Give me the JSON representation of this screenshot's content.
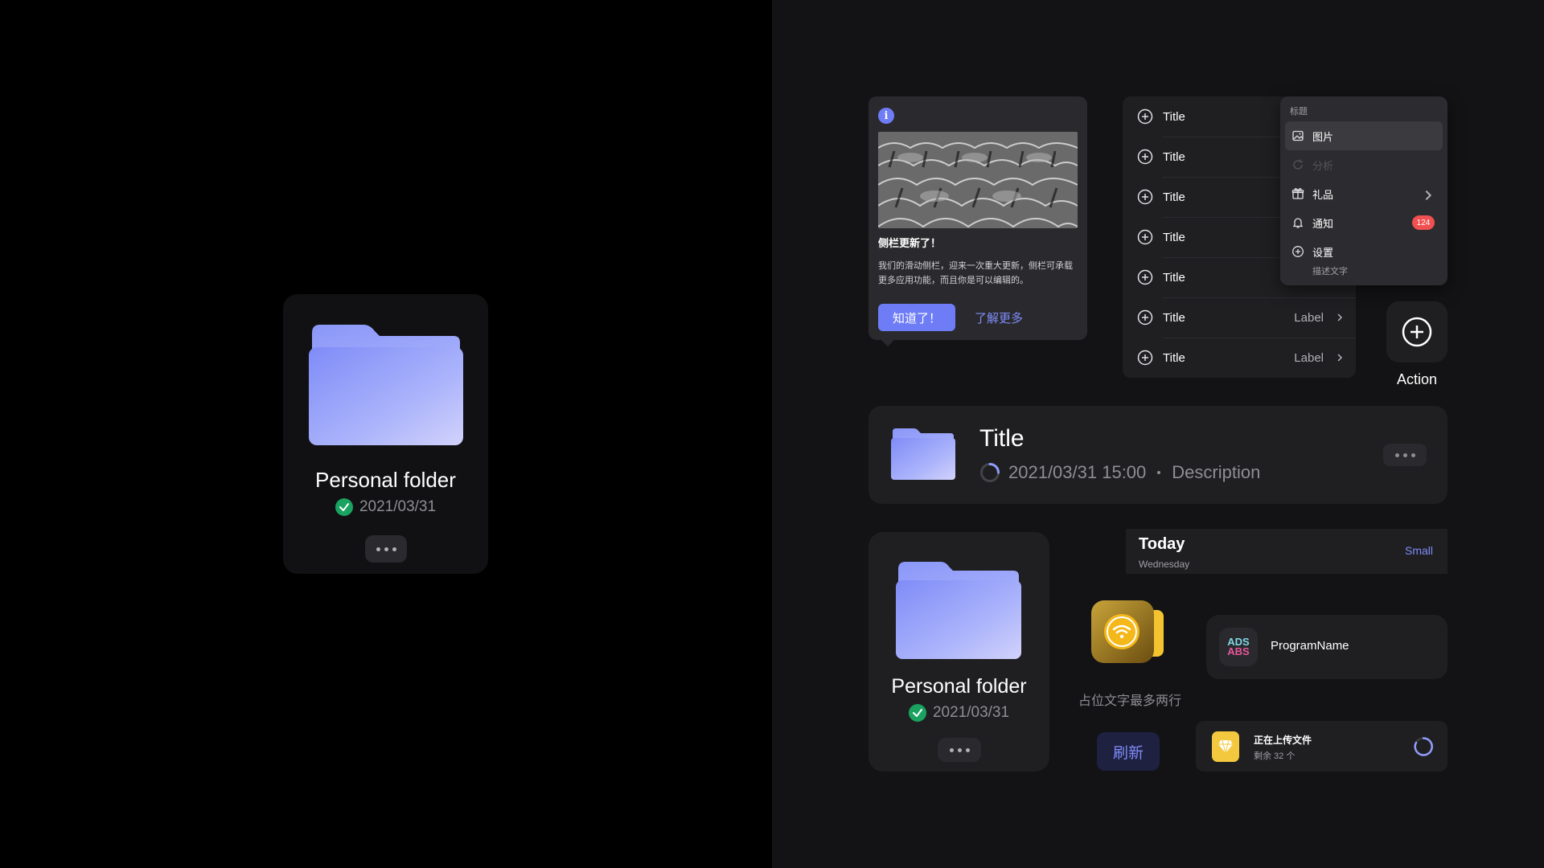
{
  "big_folder": {
    "name": "Personal folder",
    "date": "2021/03/31"
  },
  "popover": {
    "title": "侧栏更新了！",
    "body": "我们的滑动侧栏，迎来一次重大更新，侧栏可承载更多应用功能，而且你是可以编辑的。",
    "primary_button": "知道了！",
    "link_button": "了解更多"
  },
  "list": {
    "rows": [
      {
        "title": "Title",
        "label": ""
      },
      {
        "title": "Title",
        "label": ""
      },
      {
        "title": "Title",
        "label": ""
      },
      {
        "title": "Title",
        "label": ""
      },
      {
        "title": "Title",
        "label": ""
      },
      {
        "title": "Title",
        "label": "Label"
      },
      {
        "title": "Title",
        "label": "Label"
      }
    ]
  },
  "menu": {
    "header": "标题",
    "items": [
      {
        "label": "图片",
        "icon": "image-icon",
        "state": "active"
      },
      {
        "label": "分析",
        "icon": "refresh-icon",
        "state": "disabled"
      },
      {
        "label": "礼品",
        "icon": "gift-icon",
        "state": "normal"
      },
      {
        "label": "通知",
        "icon": "bell-icon",
        "state": "normal",
        "badge": "124"
      },
      {
        "label": "设置",
        "icon": "plus-circle-icon",
        "state": "normal",
        "description": "描述文字"
      }
    ]
  },
  "action": {
    "label": "Action"
  },
  "file_row": {
    "title": "Title",
    "datetime": "2021/03/31 15:00",
    "description": "Description"
  },
  "small_folder": {
    "name": "Personal folder",
    "date": "2021/03/31"
  },
  "today": {
    "title": "Today",
    "subtitle": "Wednesday",
    "size_link": "Small"
  },
  "app_widget": {
    "caption": "占位文字最多两行",
    "refresh_button": "刷新"
  },
  "program": {
    "name": "ProgramName",
    "icon_text_top": "ADS",
    "icon_text_bottom": "ABS"
  },
  "upload": {
    "title": "正在上传文件",
    "subtitle": "剩余 32 个"
  },
  "colors": {
    "accent": "#6e7df6",
    "success": "#1aa260",
    "badge": "#f0504f",
    "folder": "#8f9dfb"
  }
}
